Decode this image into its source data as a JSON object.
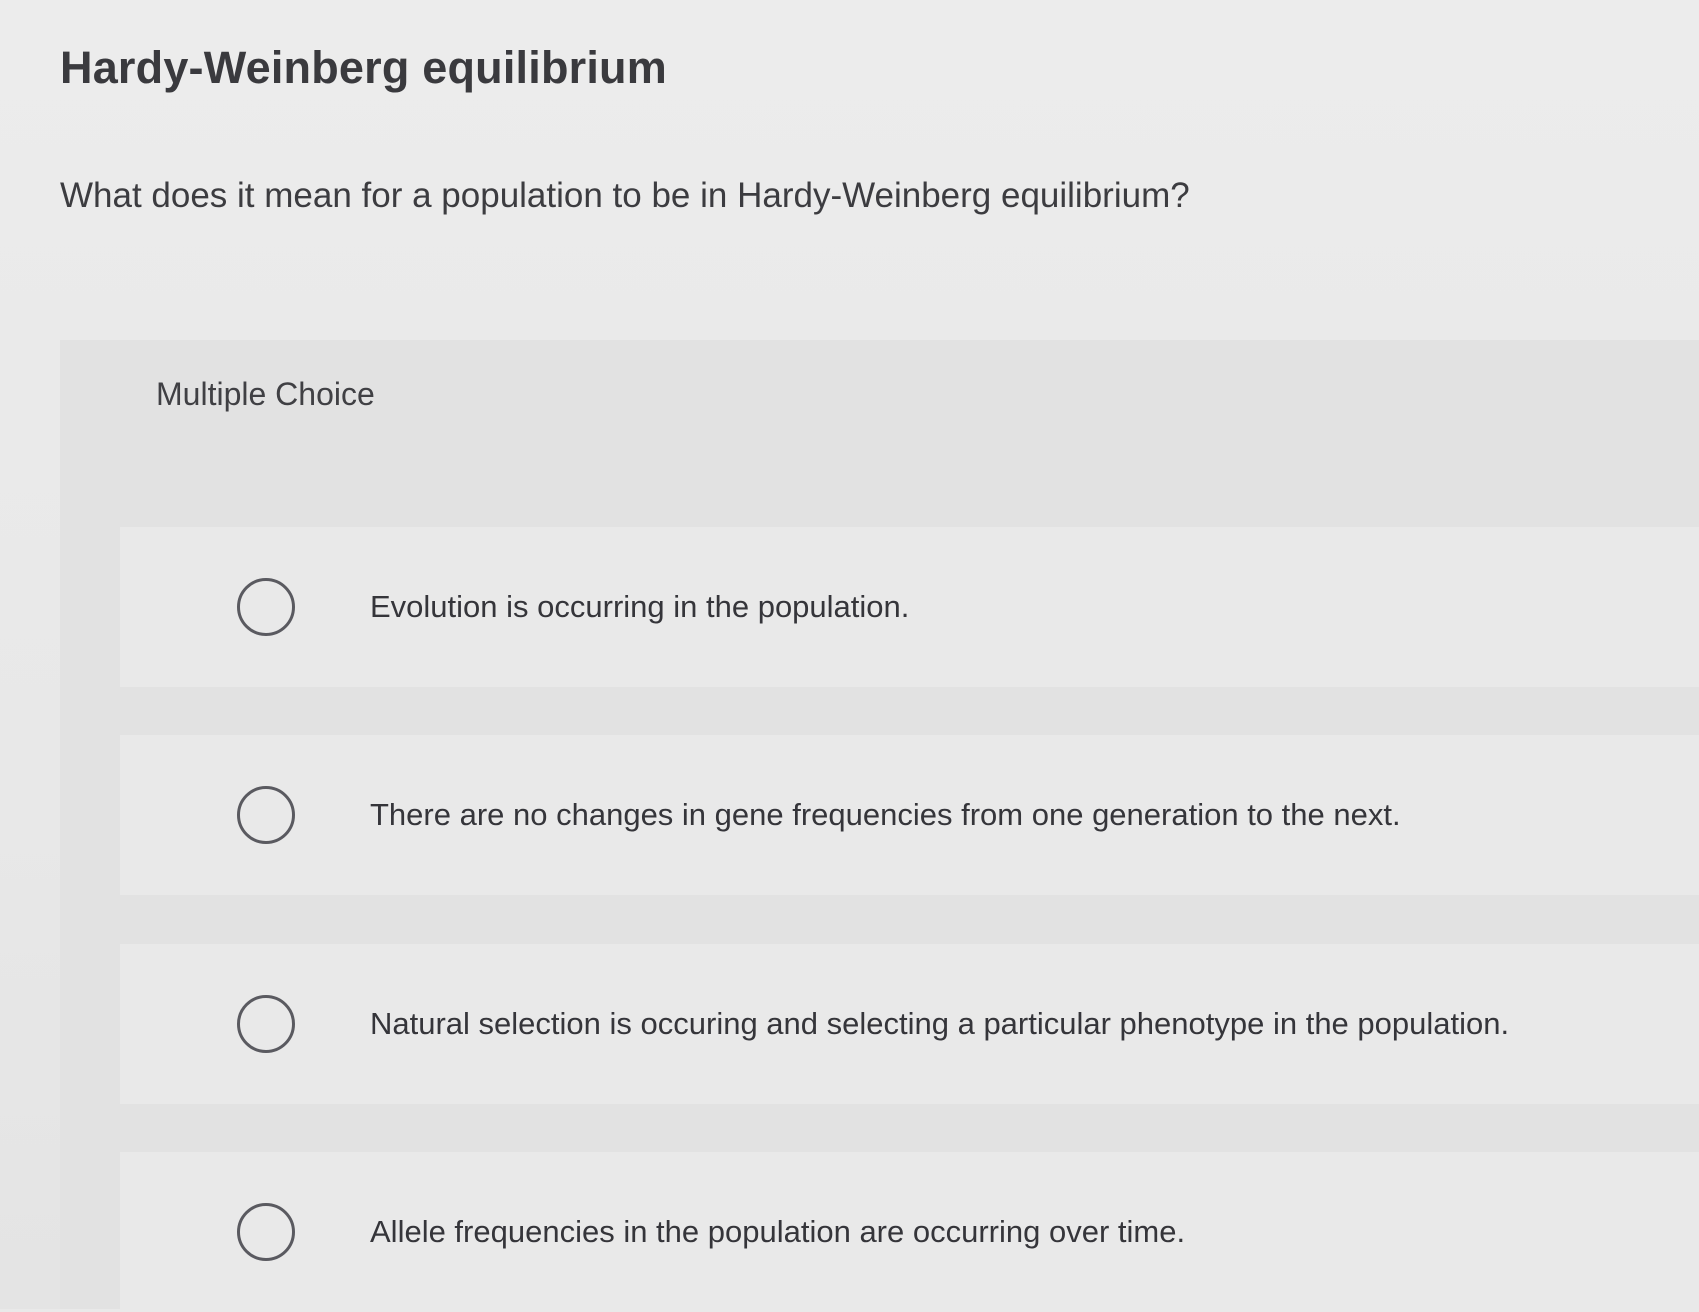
{
  "title": "Hardy-Weinberg equilibrium",
  "question": "What does it mean for a population to be in Hardy-Weinberg equilibrium?",
  "multiple_choice": {
    "label": "Multiple Choice",
    "options": [
      {
        "text": "Evolution is occurring in the population.",
        "selected": false
      },
      {
        "text": "There are no changes in gene frequencies from one generation to the next.",
        "selected": false
      },
      {
        "text": "Natural selection is occuring and selecting a particular phenotype in the population.",
        "selected": false
      },
      {
        "text": "Allele frequencies in the population are occurring over time.",
        "selected": false
      }
    ]
  },
  "colors": {
    "background": "#e9e9e9",
    "panel": "#e2e2e2",
    "text": "#35353a",
    "radio_border": "#5a5a60"
  }
}
